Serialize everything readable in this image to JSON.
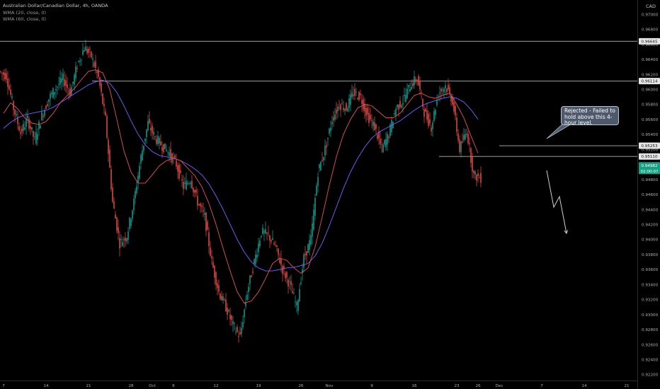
{
  "header": {
    "symbol_line": "Australian Dollar/Canadian Dollar, 4h, OANDA",
    "wma20_label": "WMA (20, close, 0)",
    "wma60_label": "WMA (60, close, 0)",
    "currency": "CAD"
  },
  "annotation": {
    "text": "Rejected - Failed to hold above this 4-hour level."
  },
  "colors": {
    "background": "#000000",
    "up": "#26a69a",
    "down": "#ef5350",
    "wma20": "#e3545d",
    "wma60": "#7b61ff",
    "level_line": "#b5b5b5",
    "current_price_bg": "#13a283",
    "arrow": "#d0d0d0"
  },
  "chart_data": {
    "type": "candlestick",
    "y_ticks": [
      "0.97000",
      "0.96800",
      "0.96600",
      "0.96400",
      "0.96200",
      "0.96000",
      "0.95800",
      "0.95600",
      "0.95400",
      "0.95200",
      "0.95000",
      "0.94800",
      "0.94600",
      "0.94400",
      "0.94200",
      "0.94000",
      "0.93800",
      "0.93600",
      "0.93400",
      "0.93200",
      "0.93000",
      "0.92800",
      "0.92600",
      "0.92400",
      "0.92200"
    ],
    "ylim": [
      0.9212,
      0.9719
    ],
    "x_ticks": [
      {
        "label": "7",
        "x": 0.5
      },
      {
        "label": "14",
        "x": 6.5
      },
      {
        "label": "21",
        "x": 12.5
      },
      {
        "label": "28",
        "x": 18.5
      },
      {
        "label": "Oct",
        "x": 21.5
      },
      {
        "label": "6",
        "x": 24.5
      },
      {
        "label": "12",
        "x": 30.5
      },
      {
        "label": "19",
        "x": 36.5
      },
      {
        "label": "26",
        "x": 42.5
      },
      {
        "label": "Nov",
        "x": 46.5
      },
      {
        "label": "9",
        "x": 52.5
      },
      {
        "label": "16",
        "x": 58.5
      },
      {
        "label": "23",
        "x": 64.5
      },
      {
        "label": "26",
        "x": 67.5
      },
      {
        "label": "Dec",
        "x": 70.5
      },
      {
        "label": "7",
        "x": 76.5
      },
      {
        "label": "14",
        "x": 82.5
      },
      {
        "label": "21",
        "x": 88.5
      }
    ],
    "xlim": [
      0,
      90
    ],
    "horizontal_levels": [
      {
        "value": 0.96645,
        "label": "0.96645",
        "from_x": 0
      },
      {
        "value": 0.96114,
        "label": "0.96114",
        "from_x": 13
      },
      {
        "value": 0.95253,
        "label": "0.95253",
        "from_x": 70.5
      },
      {
        "value": 0.9511,
        "label": "0.95110",
        "from_x": 62
      }
    ],
    "current_price": {
      "value": 0.94982,
      "label": "0.94982",
      "countdown": "02:00:07"
    },
    "projection_path": [
      [
        77.2,
        0.9492
      ],
      [
        78.2,
        0.9443
      ],
      [
        79.0,
        0.9457
      ],
      [
        80.0,
        0.9408
      ]
    ],
    "closes": [
      0.9618,
      0.9575,
      0.9542,
      0.956,
      0.9532,
      0.9565,
      0.9588,
      0.9602,
      0.9614,
      0.9595,
      0.9632,
      0.9656,
      0.9644,
      0.9615,
      0.956,
      0.945,
      0.9395,
      0.9405,
      0.945,
      0.951,
      0.9555,
      0.9535,
      0.9525,
      0.9515,
      0.95,
      0.947,
      0.948,
      0.945,
      0.943,
      0.937,
      0.933,
      0.931,
      0.9285,
      0.927,
      0.933,
      0.937,
      0.941,
      0.9405,
      0.939,
      0.936,
      0.934,
      0.931,
      0.9375,
      0.94,
      0.949,
      0.952,
      0.956,
      0.958,
      0.9575,
      0.9595,
      0.959,
      0.9565,
      0.955,
      0.952,
      0.954,
      0.9575,
      0.9585,
      0.9605,
      0.9615,
      0.957,
      0.955,
      0.9595,
      0.9605,
      0.9585,
      0.952,
      0.9545,
      0.9485,
      0.9482
    ],
    "wma20": [
      0.9568,
      0.9582,
      0.9574,
      0.9562,
      0.9555,
      0.9553,
      0.9557,
      0.9568,
      0.9582,
      0.9592,
      0.9601,
      0.9613,
      0.9624,
      0.9626,
      0.9622,
      0.96,
      0.956,
      0.9518,
      0.949,
      0.9475,
      0.9475,
      0.9486,
      0.9498,
      0.9505,
      0.9508,
      0.9505,
      0.9495,
      0.9485,
      0.947,
      0.9448,
      0.942,
      0.9388,
      0.9358,
      0.933,
      0.9315,
      0.9318,
      0.933,
      0.9348,
      0.9368,
      0.9375,
      0.9372,
      0.9362,
      0.9355,
      0.9362,
      0.939,
      0.943,
      0.9472,
      0.951,
      0.954,
      0.956,
      0.9575,
      0.958,
      0.9578,
      0.957,
      0.9562,
      0.9562,
      0.9568,
      0.958,
      0.9592,
      0.9595,
      0.959,
      0.9588,
      0.9592,
      0.9595,
      0.958,
      0.9562,
      0.9538,
      0.9515
    ],
    "wma60": [
      0.9548,
      0.9556,
      0.9562,
      0.9566,
      0.9568,
      0.957,
      0.9572,
      0.9576,
      0.9582,
      0.9588,
      0.9594,
      0.96,
      0.9606,
      0.961,
      0.9612,
      0.9608,
      0.9596,
      0.9578,
      0.9558,
      0.954,
      0.9526,
      0.9517,
      0.9512,
      0.951,
      0.9508,
      0.9505,
      0.95,
      0.9494,
      0.9486,
      0.9474,
      0.9458,
      0.944,
      0.942,
      0.94,
      0.9383,
      0.937,
      0.9362,
      0.9358,
      0.9358,
      0.936,
      0.9362,
      0.9363,
      0.9365,
      0.9368,
      0.9378,
      0.9395,
      0.9418,
      0.9443,
      0.9468,
      0.949,
      0.9508,
      0.9523,
      0.9535,
      0.9543,
      0.9548,
      0.9553,
      0.9558,
      0.9565,
      0.9572,
      0.9578,
      0.9582,
      0.9585,
      0.9588,
      0.959,
      0.9588,
      0.9583,
      0.9573,
      0.956
    ]
  }
}
